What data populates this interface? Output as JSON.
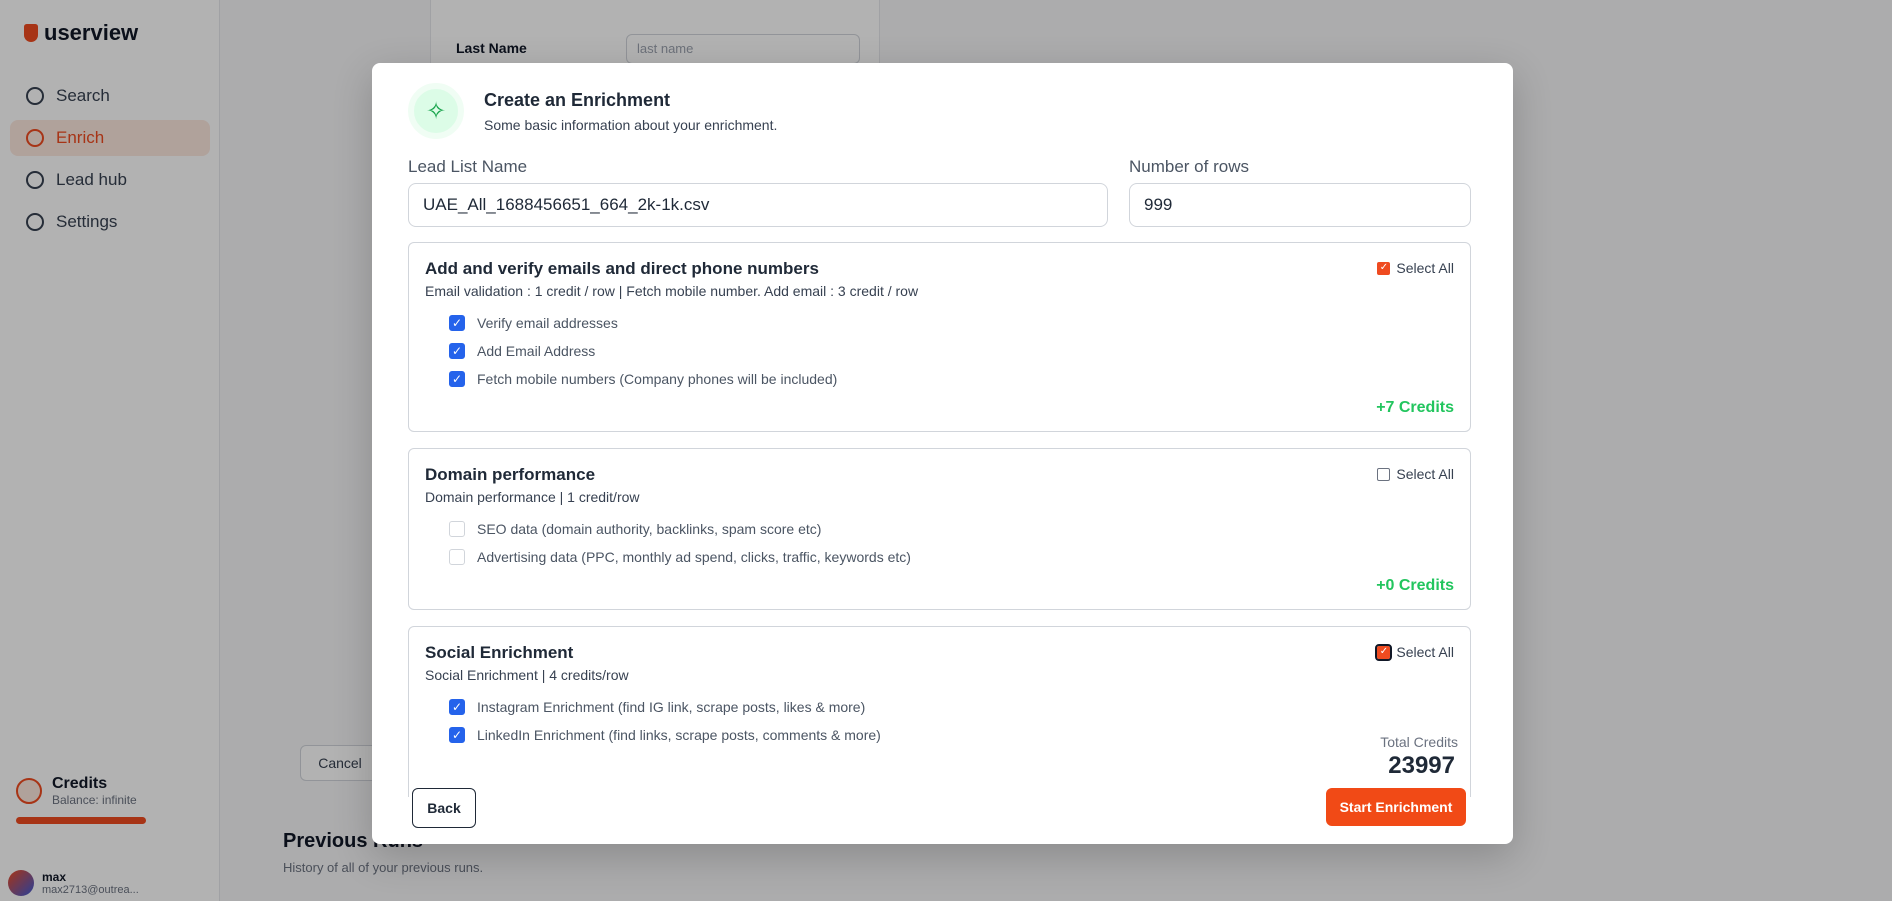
{
  "background": {
    "brand": "userview",
    "nav": [
      {
        "label": "Search",
        "icon": "search-icon",
        "active": false
      },
      {
        "label": "Enrich",
        "icon": "wand-icon",
        "active": true
      },
      {
        "label": "Lead hub",
        "icon": "book-icon",
        "active": false
      },
      {
        "label": "Settings",
        "icon": "gear-icon",
        "active": false
      }
    ],
    "credits": {
      "title": "Credits",
      "subtitle": "Balance: infinite"
    },
    "user": {
      "name": "max",
      "email": "max2713@outrea..."
    },
    "form_label": "Last Name",
    "form_select": "last name",
    "cancel": "Cancel",
    "previous_title": "Previous Runs",
    "previous_sub": "History of all of your previous runs."
  },
  "modal": {
    "title": "Create an Enrichment",
    "subtitle": "Some basic information about your enrichment.",
    "lead_list_label": "Lead List Name",
    "lead_list_value": "UAE_All_1688456651_664_2k-1k.csv",
    "rows_label": "Number of rows",
    "rows_value": "999",
    "sections": [
      {
        "title": "Add and verify emails and direct phone numbers",
        "description": "Email validation : 1 credit / row | Fetch mobile number. Add email : 3 credit / row",
        "select_all": "Select All",
        "select_all_checked": true,
        "options": [
          {
            "label": "Verify email addresses",
            "checked": true
          },
          {
            "label": "Add Email Address",
            "checked": true
          },
          {
            "label": "Fetch mobile numbers (Company phones will be included)",
            "checked": true
          }
        ],
        "credits": "+7 Credits"
      },
      {
        "title": "Domain performance",
        "description": "Domain performance | 1 credit/row",
        "select_all": "Select All",
        "select_all_checked": false,
        "options": [
          {
            "label": "SEO data (domain authority, backlinks, spam score etc)",
            "checked": false
          },
          {
            "label": "Advertising data (PPC, monthly ad spend, clicks, traffic, keywords etc)",
            "checked": false
          }
        ],
        "credits": "+0 Credits"
      },
      {
        "title": "Social Enrichment",
        "description": "Social Enrichment | 4 credits/row",
        "select_all": "Select All",
        "select_all_checked": true,
        "options": [
          {
            "label": "Instagram Enrichment (find IG link, scrape posts, likes & more)",
            "checked": true
          },
          {
            "label": "LinkedIn Enrichment (find links, scrape posts, comments & more)",
            "checked": true
          }
        ]
      }
    ],
    "total_label": "Total Credits",
    "total_value": "23997",
    "back": "Back",
    "start": "Start Enrichment"
  }
}
